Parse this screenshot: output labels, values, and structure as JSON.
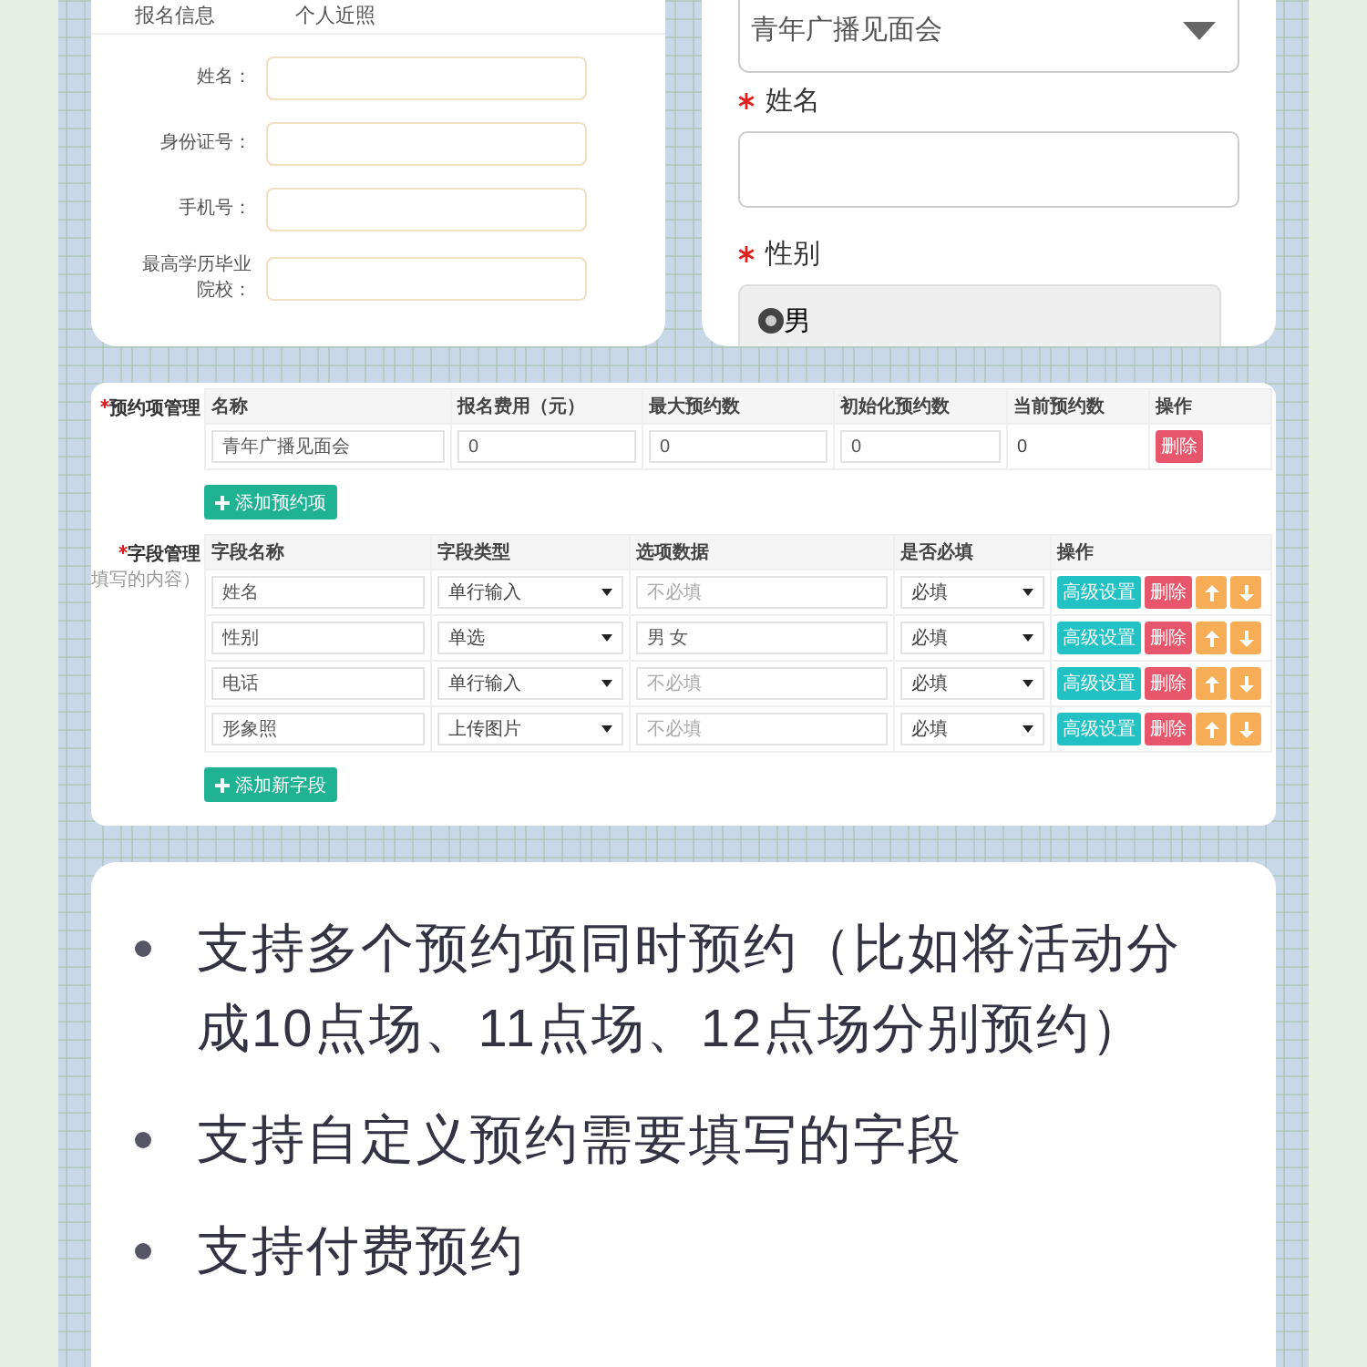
{
  "registration_form": {
    "header_labels": [
      "报名信息",
      "个人近照"
    ],
    "fields": [
      {
        "label": "姓名："
      },
      {
        "label": "身份证号："
      },
      {
        "label": "手机号："
      },
      {
        "label": "最高学历毕业院校："
      }
    ]
  },
  "mobile_form": {
    "select_value": "青年广播见面会",
    "fields": [
      {
        "label": "姓名",
        "required": true,
        "kind": "text"
      },
      {
        "label": "性别",
        "required": true,
        "kind": "radio",
        "options": [
          {
            "label": "男",
            "selected": true
          }
        ]
      }
    ]
  },
  "admin": {
    "booking_items": {
      "label": "预约项管理",
      "required": true,
      "columns": [
        "名称",
        "报名费用（元）",
        "最大预约数",
        "初始化预约数",
        "当前预约数",
        "操作"
      ],
      "rows": [
        {
          "name": "青年广播见面会",
          "fee": "0",
          "max": "0",
          "initial": "0",
          "current": "0",
          "delete": "删除"
        }
      ],
      "add_button": "添加预约项"
    },
    "field_management": {
      "label": "字段管理",
      "required": true,
      "note": "填写的内容）",
      "columns": [
        "字段名称",
        "字段类型",
        "选项数据",
        "是否必填",
        "操作"
      ],
      "rows": [
        {
          "name": "姓名",
          "type": "单行输入",
          "options": {
            "placeholder": "不必填"
          },
          "required": "必填",
          "settings": "高级设置",
          "delete": "删除"
        },
        {
          "name": "性别",
          "type": "单选",
          "options": {
            "value": "男 女"
          },
          "required": "必填",
          "settings": "高级设置",
          "delete": "删除"
        },
        {
          "name": "电话",
          "type": "单行输入",
          "options": {
            "placeholder": "不必填"
          },
          "required": "必填",
          "settings": "高级设置",
          "delete": "删除"
        },
        {
          "name": "形象照",
          "type": "上传图片",
          "options": {
            "placeholder": "不必填"
          },
          "required": "必填",
          "settings": "高级设置",
          "delete": "删除"
        }
      ],
      "add_button": "添加新字段"
    }
  },
  "features": [
    "支持多个预约项同时预约（比如将活动分成10点场、11点场、12点场分别预约）",
    "支持自定义预约需要填写的字段",
    "支持付费预约"
  ]
}
